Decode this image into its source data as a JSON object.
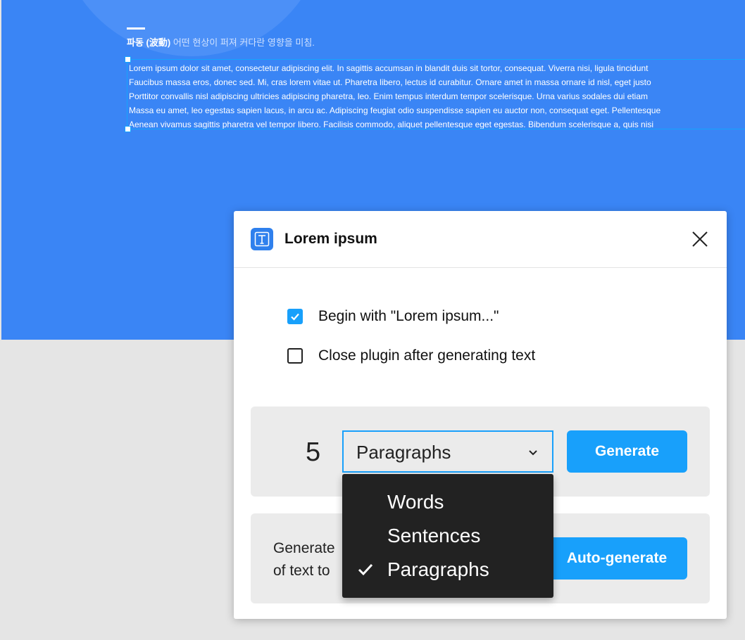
{
  "canvas": {
    "caption_bold": "파동 (波動)",
    "caption_rest": "어떤 현상이 퍼져 커다란 영향을 미침.",
    "lorem_lines": [
      "Lorem ipsum dolor sit amet, consectetur adipiscing elit. In sagittis accumsan in blandit duis sit tortor, consequat. Viverra nisi, ligula tincidunt",
      "Faucibus massa eros, donec sed. Mi, cras lorem vitae ut. Pharetra libero, lectus id curabitur. Ornare amet in massa ornare id nisl, eget justo",
      "Porttitor convallis nisl adipiscing ultricies adipiscing pharetra, leo. Enim tempus interdum tempor scelerisque. Urna varius sodales dui etiam",
      "Massa eu amet, leo egestas sapien lacus, in arcu ac. Adipiscing feugiat odio suspendisse sapien eu auctor non, consequat eget. Pellentesque",
      "Aenean vivamus sagittis pharetra vel tempor libero. Facilisis commodo, aliquet pellentesque eget egestas. Bibendum scelerisque a, quis nisi"
    ]
  },
  "dialog": {
    "title": "Lorem ipsum",
    "icon": "text-t-icon",
    "options": [
      {
        "label": "Begin with \"Lorem ipsum...\"",
        "checked": true
      },
      {
        "label": "Close plugin after generating text",
        "checked": false
      }
    ],
    "count": "5",
    "unit_selected": "Paragraphs",
    "generate_label": "Generate",
    "auto_text_line1": "Generate",
    "auto_text_line2": "of text to",
    "auto_generate_label": "Auto-generate"
  },
  "dropdown": {
    "items": [
      {
        "label": "Words",
        "selected": false
      },
      {
        "label": "Sentences",
        "selected": false
      },
      {
        "label": "Paragraphs",
        "selected": true
      }
    ]
  },
  "colors": {
    "canvas_blue": "#3a85f5",
    "accent": "#18a0fb",
    "menu_bg": "#222222"
  }
}
